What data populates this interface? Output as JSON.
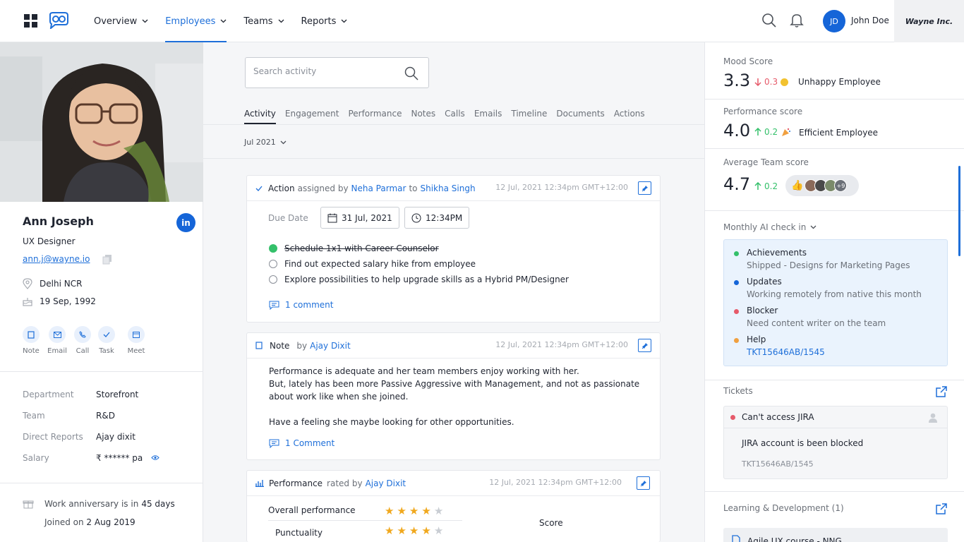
{
  "header": {
    "nav": [
      {
        "label": "Overview",
        "active": false
      },
      {
        "label": "Employees",
        "active": true
      },
      {
        "label": "Teams",
        "active": false
      },
      {
        "label": "Reports",
        "active": false
      }
    ],
    "user": {
      "initials": "JD",
      "name": "John Doe"
    },
    "company": "Wayne Inc."
  },
  "profile": {
    "name": "Ann Joseph",
    "linkedin": "in",
    "role": "UX Designer",
    "email": "ann.j@wayne.io",
    "location": "Delhi NCR",
    "birthday": "19 Sep, 1992",
    "quick_actions": [
      "Note",
      "Email",
      "Call",
      "Task",
      "Meet"
    ],
    "details": [
      {
        "key": "Department",
        "value": "Storefront"
      },
      {
        "key": "Team",
        "value": "R&D"
      },
      {
        "key": "Direct Reports",
        "value": "Ajay dixit"
      },
      {
        "key": "Salary",
        "value": "₹ ****** pa"
      }
    ],
    "anniversary_prefix": "Work anniversary is in",
    "anniversary_days": "45 days",
    "joined_prefix": "Joined on",
    "joined_date": "2 Aug 2019"
  },
  "activity": {
    "search_placeholder": "Search activity",
    "tabs": [
      "Activity",
      "Engagement",
      "Performance",
      "Notes",
      "Calls",
      "Emails",
      "Timeline",
      "Documents",
      "Actions"
    ],
    "month": "Jul 2021",
    "action_card": {
      "title": "Action",
      "assigned_by_text": "assigned by",
      "from": "Neha Parmar",
      "to_text": "to",
      "to": "Shikha Singh",
      "timestamp": "12 Jul, 2021  12:34pm GMT+12:00",
      "due_label": "Due Date",
      "due_date": "31 Jul, 2021",
      "due_time": "12:34PM",
      "tasks": [
        {
          "text": "Schedule 1x1 with Career Counselor",
          "done": true
        },
        {
          "text": "Find out expected salary hike from employee",
          "done": false
        },
        {
          "text": "Explore possibilities to help upgrade skills as a Hybrid PM/Designer",
          "done": false
        }
      ],
      "comments": "1 comment"
    },
    "note_card": {
      "title": "Note",
      "by_text": "by",
      "author": "Ajay Dixit",
      "timestamp": "12 Jul, 2021  12:34pm GMT+12:00",
      "body": "Performance is adequate and her team members enjoy working with her.\nBut, lately has been more Passive Aggressive with Management, and not as passionate about work like when she joined.\n\nHave a feeling she maybe looking for other opportunities.",
      "comments": "1 Comment"
    },
    "performance_card": {
      "title": "Performance",
      "rated_text": "rated by",
      "author": "Ajay Dixit",
      "timestamp": "12 Jul, 2021  12:34pm GMT+12:00",
      "rows": [
        {
          "label": "Overall performance",
          "stars": 4,
          "max": 5
        },
        {
          "label": "Punctuality",
          "stars": 4,
          "max": 5
        }
      ],
      "score_label": "Score"
    }
  },
  "scores": {
    "mood": {
      "label": "Mood Score",
      "value": "3.3",
      "delta": "0.3",
      "direction": "down",
      "desc": "Unhappy Employee"
    },
    "performance": {
      "label": "Performance score",
      "value": "4.0",
      "delta": "0.2",
      "direction": "up",
      "desc": "Efficient Employee"
    },
    "team": {
      "label": "Average Team score",
      "value": "4.7",
      "delta": "0.2",
      "direction": "up",
      "more": "+9"
    }
  },
  "ai_checkin": {
    "title": "Monthly AI check in",
    "items": [
      {
        "title": "Achievements",
        "sub": "Shipped - Designs for Marketing Pages",
        "color": "#34c06a"
      },
      {
        "title": "Updates",
        "sub": "Working remotely from native this month",
        "color": "#1565d8"
      },
      {
        "title": "Blocker",
        "sub": "Need content writer on the team",
        "color": "#e65a6a"
      },
      {
        "title": "Help",
        "sub": "TKT15646AB/1545",
        "color": "#f0a040"
      }
    ]
  },
  "tickets": {
    "title": "Tickets",
    "item": {
      "title": "Can't access JIRA",
      "desc": "JIRA account is been blocked",
      "id": "TKT15646AB/1545"
    }
  },
  "learning": {
    "title": "Learning & Development (1)",
    "course": "Agile UX course - NNG"
  },
  "colors": {
    "accent": "#1e6fd9",
    "up": "#34c06a",
    "down": "#e65a6a"
  }
}
